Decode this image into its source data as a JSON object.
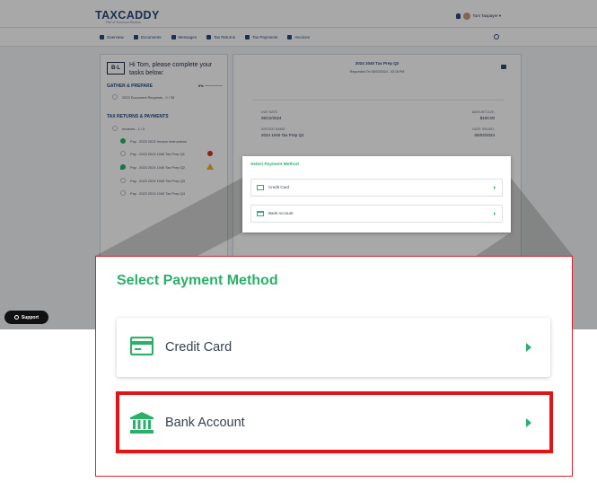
{
  "app": {
    "logo": "TAXCADDY",
    "logo_sub": "Part of Thomson Reuters",
    "user_name": "Tom Taxpayer ▾",
    "nav": [
      "Overview",
      "Documents",
      "Messages",
      "Tax Returns",
      "Tax Payments",
      "Invoices"
    ]
  },
  "panel": {
    "logo_text": "B·L",
    "greeting": "Hi Tom, please complete your tasks below:",
    "gather": {
      "title": "GATHER & PREPARE",
      "percent": "0%",
      "item": "2023 Document Requests - 0 / 35"
    },
    "returns": {
      "title": "TAX RETURNS & PAYMENTS",
      "invoices": "Invoices - 1 / 5",
      "items": [
        "Pay - 2023 2024 Invoice Instructions",
        "Pay - 2023 2024 1040 Tax Prep Q1",
        "Pay - 2023 2024 1040 Tax Prep Q2",
        "Pay - 2023 2024 1040 Tax Prep Q3",
        "Pay - 2023 2024 1040 Tax Prep Q4"
      ]
    }
  },
  "invoice": {
    "title": "2024 1040 Tax Prep Q2",
    "requested": "Requested On 05/02/2024 - 03:16 PM",
    "due_label": "DUE DATE:",
    "due_value": "05/12/2024",
    "amount_label": "AMOUNT DUE:",
    "amount_value": "$100.00",
    "name_label": "INVOICE NAME:",
    "name_value": "2024 1040 Tax Prep Q2",
    "issued_label": "DATE ISSUED:",
    "issued_value": "05/02/2024"
  },
  "popup": {
    "title": "Select Payment Method",
    "credit_label": "Credit Card",
    "bank_label": "Bank Account"
  },
  "support": {
    "label": "Support"
  },
  "zoom": {
    "title": "Select Payment Method",
    "credit_label": "Credit Card",
    "bank_label": "Bank Account"
  },
  "colors": {
    "brand": "#2b4a7c",
    "accent": "#2bb068",
    "highlight": "#e01515"
  }
}
